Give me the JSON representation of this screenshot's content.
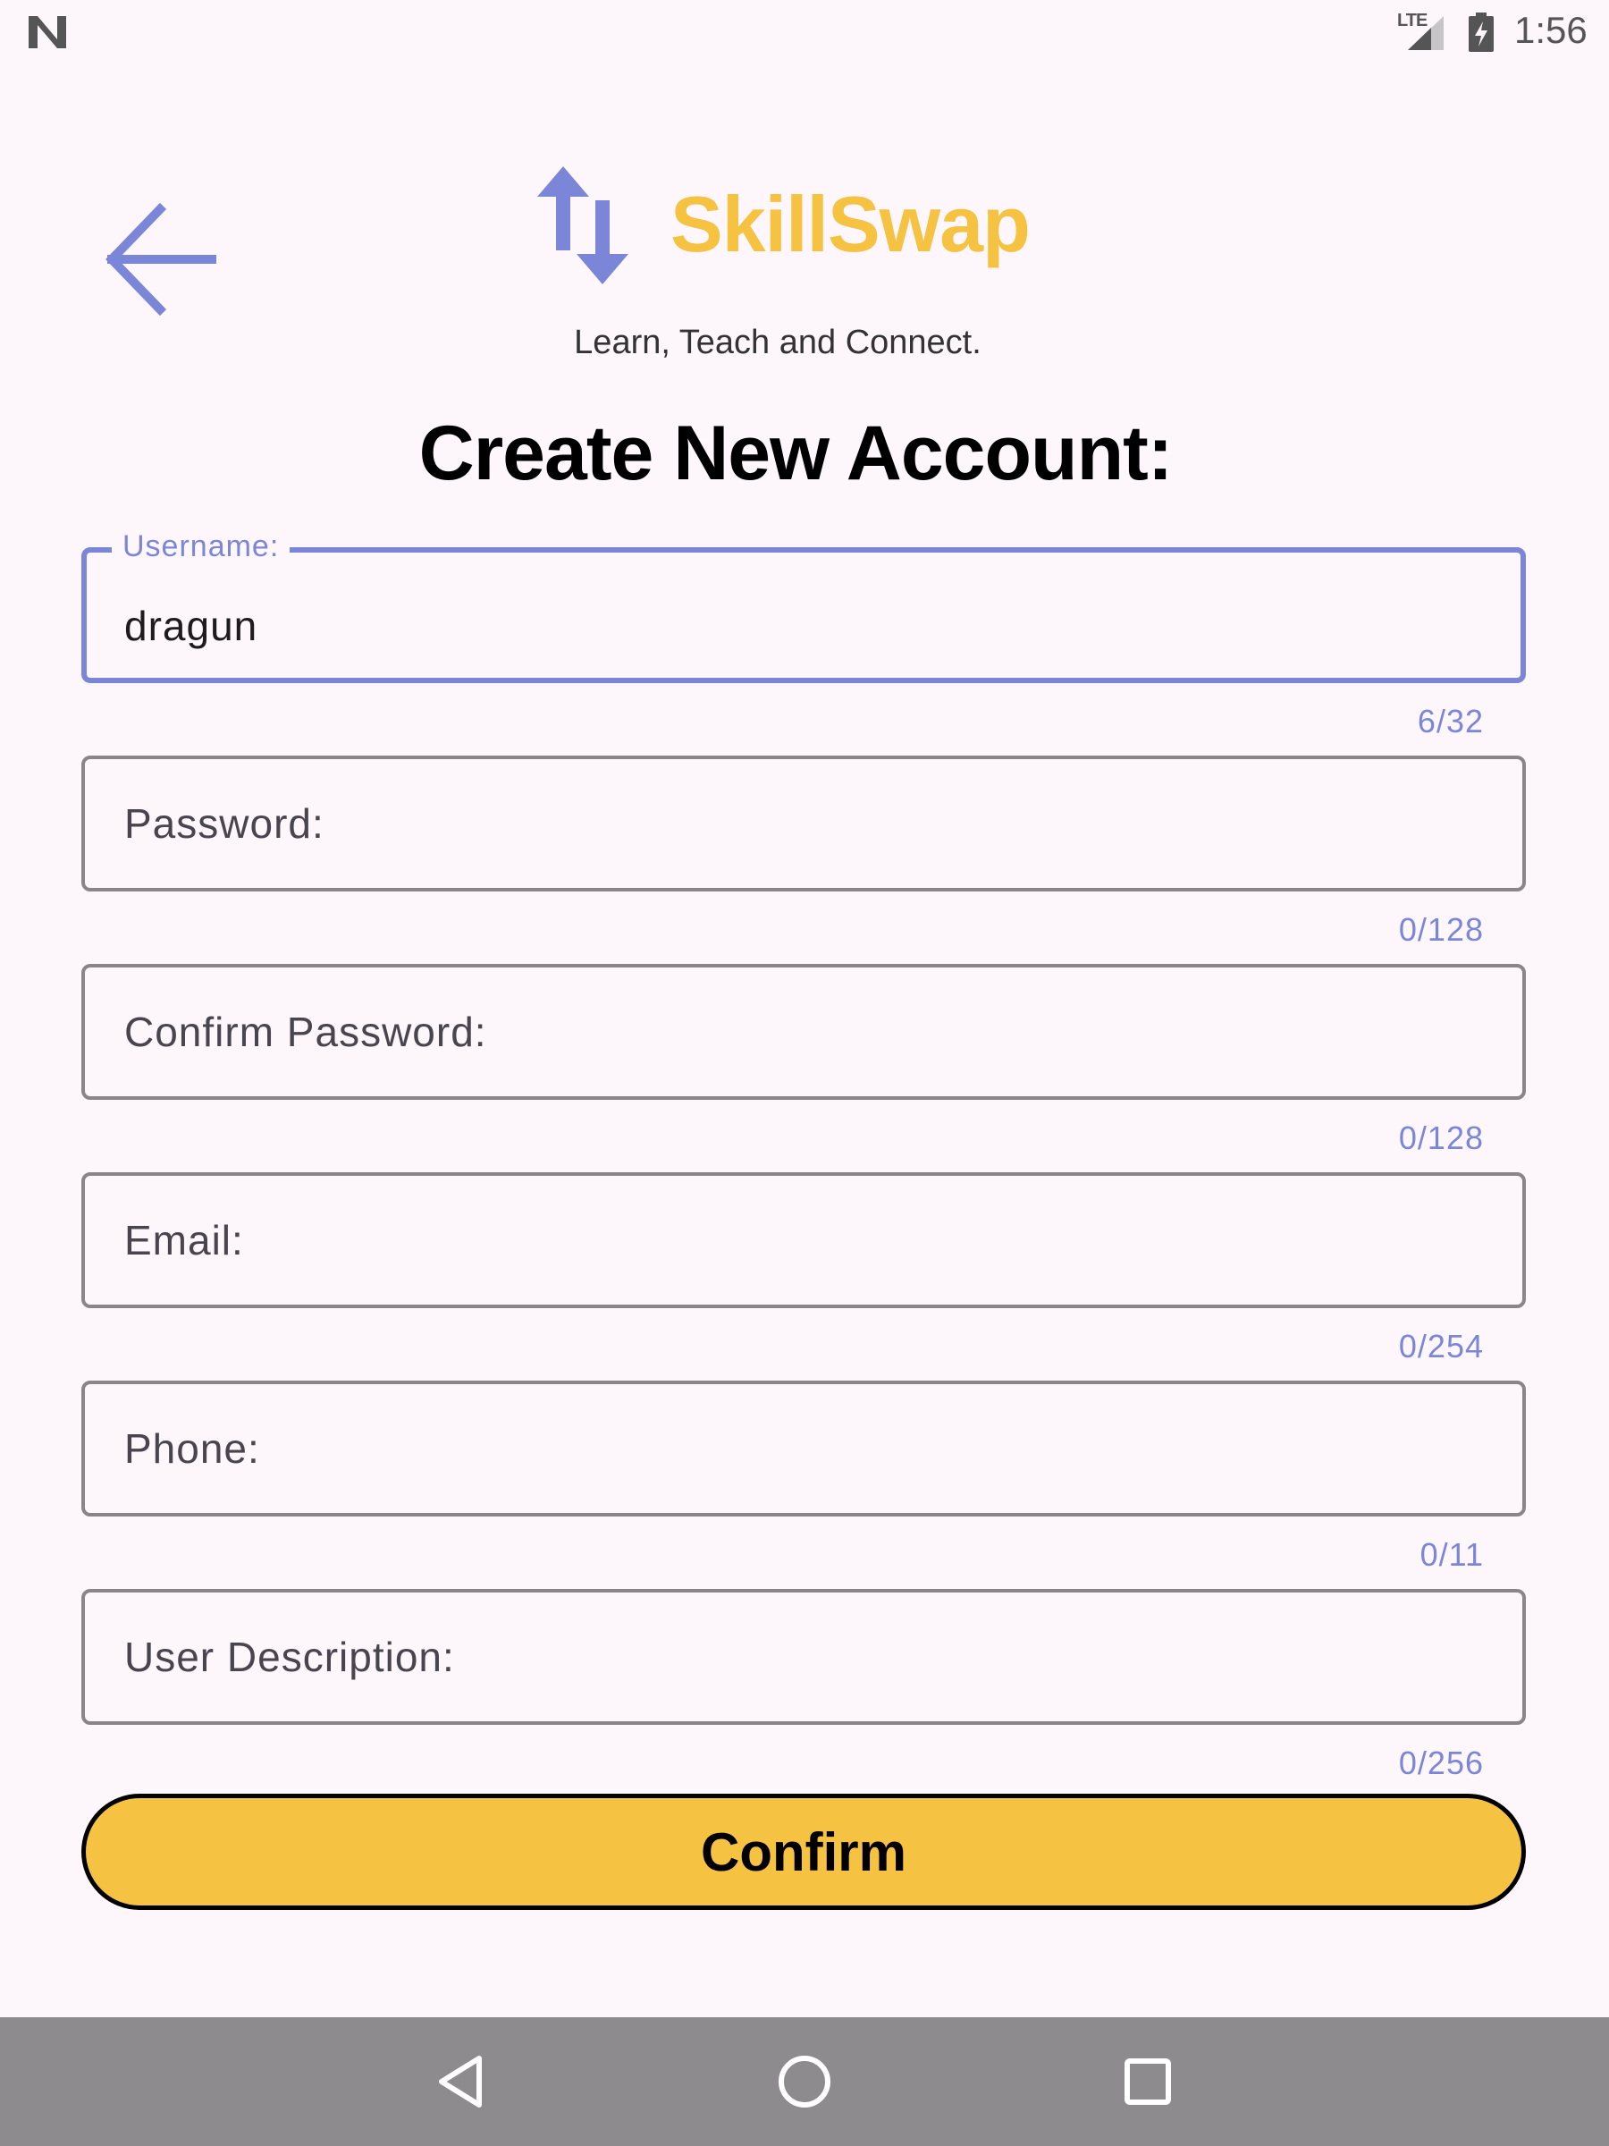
{
  "status_bar": {
    "network": "LTE",
    "time": "1:56"
  },
  "header": {
    "brand_name": "SkillSwap",
    "tagline": "Learn, Teach and Connect."
  },
  "page_title": "Create New Account:",
  "form": {
    "username": {
      "label": "Username:",
      "value": "dragun",
      "counter": "6/32"
    },
    "password": {
      "placeholder": "Password:",
      "counter": "0/128"
    },
    "confirm_password": {
      "placeholder": "Confirm Password:",
      "counter": "0/128"
    },
    "email": {
      "placeholder": "Email:",
      "counter": "0/254"
    },
    "phone": {
      "placeholder": "Phone:",
      "counter": "0/11"
    },
    "description": {
      "placeholder": "User Description:",
      "counter": "0/256"
    }
  },
  "confirm_label": "Confirm",
  "icons": {
    "back": "arrow-back-icon",
    "brand": "swap-vertical-icon",
    "nav_back": "triangle-back-icon",
    "nav_home": "circle-home-icon",
    "nav_recents": "square-recents-icon"
  },
  "colors": {
    "accent": "#7b86d8",
    "brand": "#f5c242",
    "background": "#fdf7fc",
    "nav_bar": "#8e8b8e"
  }
}
